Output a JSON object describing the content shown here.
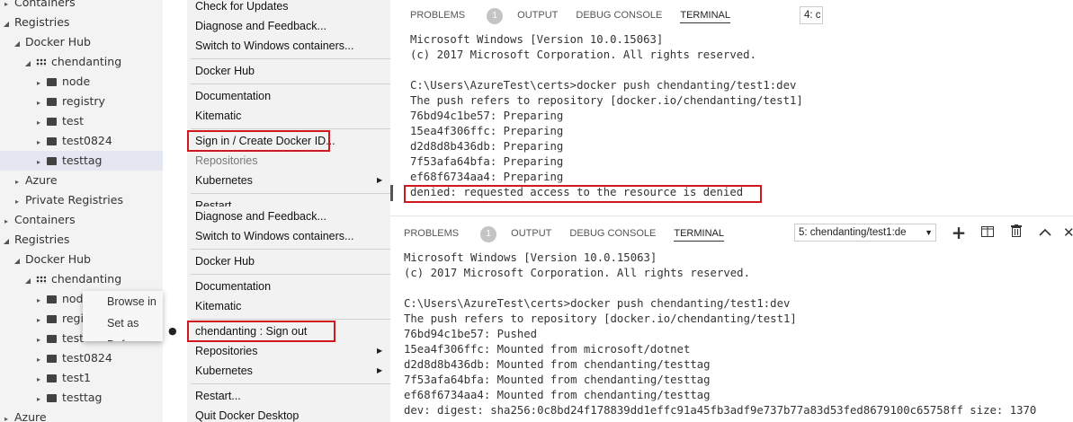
{
  "top_tree": {
    "items": [
      {
        "label": "Containers",
        "level": 0,
        "caret": "▸"
      },
      {
        "label": "Registries",
        "level": 0,
        "caret": "◢"
      },
      {
        "label": "Docker Hub",
        "level": 1,
        "caret": "◢"
      },
      {
        "label": "chendanting",
        "level": 2,
        "caret": "◢",
        "icon": "dots"
      },
      {
        "label": "node",
        "level": 3,
        "caret": "▸",
        "icon": "folder"
      },
      {
        "label": "registry",
        "level": 3,
        "caret": "▸",
        "icon": "folder"
      },
      {
        "label": "test",
        "level": 3,
        "caret": "▸",
        "icon": "folder"
      },
      {
        "label": "test0824",
        "level": 3,
        "caret": "▸",
        "icon": "folder"
      },
      {
        "label": "testtag",
        "level": 3,
        "caret": "▸",
        "icon": "folder",
        "selected": true
      },
      {
        "label": "Azure",
        "level": 1,
        "caret": "▸"
      },
      {
        "label": "Private Registries",
        "level": 1,
        "caret": "▸"
      }
    ]
  },
  "bottom_tree": {
    "items": [
      {
        "label": "Containers",
        "level": 0,
        "caret": "▸"
      },
      {
        "label": "Registries",
        "level": 0,
        "caret": "◢"
      },
      {
        "label": "Docker Hub",
        "level": 1,
        "caret": "◢"
      },
      {
        "label": "chendanting",
        "level": 2,
        "caret": "◢",
        "icon": "dots"
      },
      {
        "label": "node",
        "level": 3,
        "caret": "▸",
        "icon": "folder"
      },
      {
        "label": "registry",
        "level": 3,
        "caret": "▸",
        "icon": "folder"
      },
      {
        "label": "test",
        "level": 3,
        "caret": "▸",
        "icon": "folder"
      },
      {
        "label": "test0824",
        "level": 3,
        "caret": "▸",
        "icon": "folder"
      },
      {
        "label": "test1",
        "level": 3,
        "caret": "▸",
        "icon": "folder"
      },
      {
        "label": "testtag",
        "level": 3,
        "caret": "▸",
        "icon": "folder"
      },
      {
        "label": "Azure",
        "level": 0,
        "caret": "▸"
      }
    ]
  },
  "context_menu": {
    "items": [
      "Browse in",
      "Set as Defa"
    ]
  },
  "top_menu": {
    "check_updates": "Check for Updates",
    "diagnose": "Diagnose and Feedback...",
    "switch": "Switch to Windows containers...",
    "docker_hub": "Docker Hub",
    "documentation": "Documentation",
    "kitematic": "Kitematic",
    "sign_in": "Sign in / Create Docker ID...",
    "repositories": "Repositories",
    "kubernetes": "Kubernetes",
    "restart": "Restart..."
  },
  "bottom_menu": {
    "diagnose": "Diagnose and Feedback...",
    "switch": "Switch to Windows containers...",
    "docker_hub": "Docker Hub",
    "documentation": "Documentation",
    "kitematic": "Kitematic",
    "sign_out": "chendanting : Sign out",
    "repositories": "Repositories",
    "kubernetes": "Kubernetes",
    "restart": "Restart...",
    "quit": "Quit Docker Desktop"
  },
  "top_panel": {
    "tabs": {
      "problems": "PROBLEMS",
      "problems_count": "1",
      "output": "OUTPUT",
      "debug": "DEBUG CONSOLE",
      "terminal": "TERMINAL"
    },
    "terminal_select": "4: c",
    "lines": [
      "Microsoft Windows [Version 10.0.15063]",
      "(c) 2017 Microsoft Corporation. All rights reserved.",
      "",
      "C:\\Users\\AzureTest\\certs>docker push chendanting/test1:dev",
      "The push refers to repository [docker.io/chendanting/test1]",
      "76bd94c1be57: Preparing",
      "15ea4f306ffc: Preparing",
      "d2d8d8b436db: Preparing",
      "7f53afa64bfa: Preparing",
      "ef68f6734aa4: Preparing"
    ],
    "denied": "denied: requested access to the resource is denied"
  },
  "bottom_panel": {
    "tabs": {
      "problems": "PROBLEMS",
      "problems_count": "1",
      "output": "OUTPUT",
      "debug": "DEBUG CONSOLE",
      "terminal": "TERMINAL"
    },
    "terminal_select": "5: chendanting/test1:de",
    "lines": [
      "Microsoft Windows [Version 10.0.15063]",
      "(c) 2017 Microsoft Corporation. All rights reserved.",
      "",
      "C:\\Users\\AzureTest\\certs>docker push chendanting/test1:dev",
      "The push refers to repository [docker.io/chendanting/test1]",
      "76bd94c1be57: Pushed",
      "15ea4f306ffc: Mounted from microsoft/dotnet",
      "d2d8d8b436db: Mounted from chendanting/testtag",
      "7f53afa64bfa: Mounted from chendanting/testtag",
      "ef68f6734aa4: Mounted from chendanting/testtag",
      "dev: digest: sha256:0c8bd24f178839dd1effc91a45fb3adf9e737b77a83d53fed8679100c65758ff size: 1370"
    ]
  },
  "colors": {
    "highlight_red": "#d0191f",
    "selection": "#e4e6f1"
  }
}
